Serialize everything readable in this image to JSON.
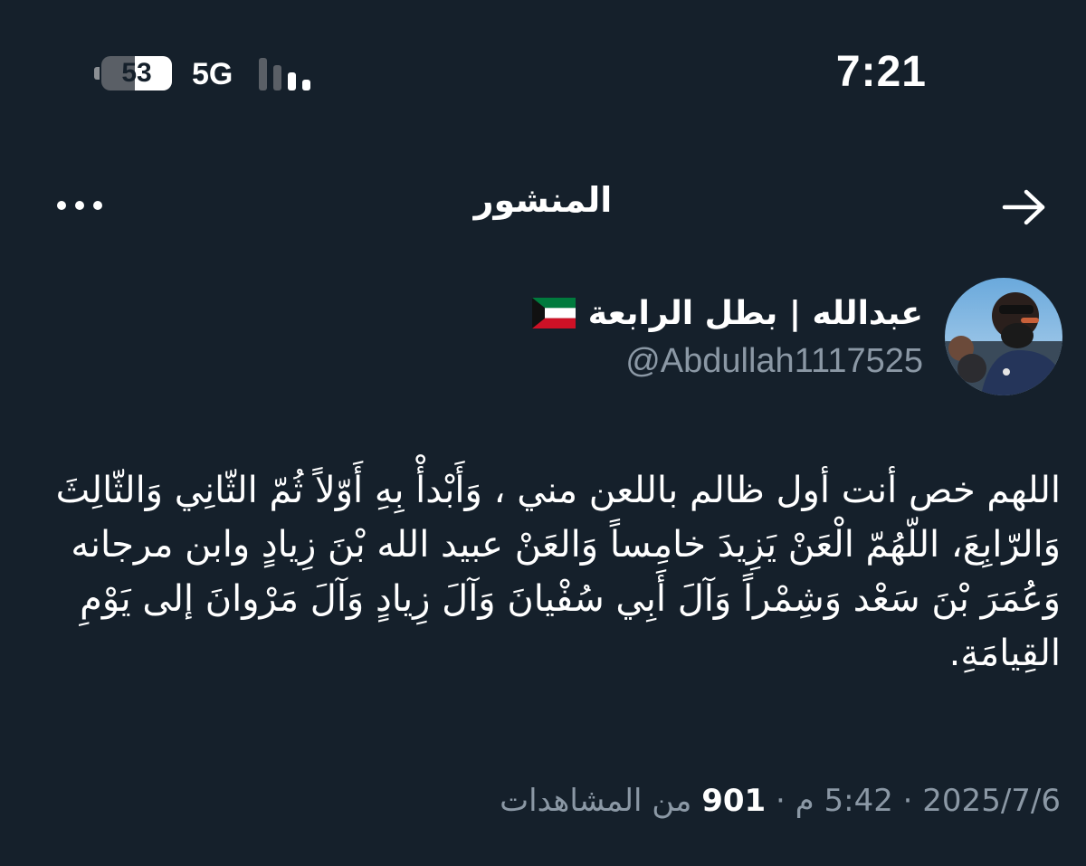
{
  "status_bar": {
    "time": "7:21",
    "battery_level": "53",
    "network": "5G",
    "signal_bars": 2
  },
  "header": {
    "title": "المنشور"
  },
  "author": {
    "display_name": "عبدالله | بطل الرابعة",
    "handle": "@Abdullah1117525",
    "flag": "kuwait-flag-icon"
  },
  "tweet": {
    "text": "اللهم خص أنت أول ظالم باللعن مني ، وَأَبْدأْ بِهِ أَوّلاً ثُمّ الثّانِي وَالثّالِثَ وَالرّابِعَ، اللّهُمّ الْعَنْ يَزِيدَ خامِساً وَالعَنْ عبيد الله بْنَ زِيادٍ وابن مرجانه وَعُمَرَ بْنَ سَعْد وَشِمْراً وَآلَ أَبِي سُفْيانَ وَآلَ زِيادٍ وَآلَ مَرْوانَ إلى يَوْمِ القِيامَةِ."
  },
  "meta": {
    "date": "2025/7/6",
    "time": "5:42 م",
    "views_count": "901",
    "views_label": "من المشاهدات",
    "separator": "·"
  },
  "colors": {
    "background": "#15202b",
    "text_primary": "#ffffff",
    "text_secondary": "#8b98a5",
    "flag_green": "#007a3d",
    "flag_red": "#ce1126"
  }
}
